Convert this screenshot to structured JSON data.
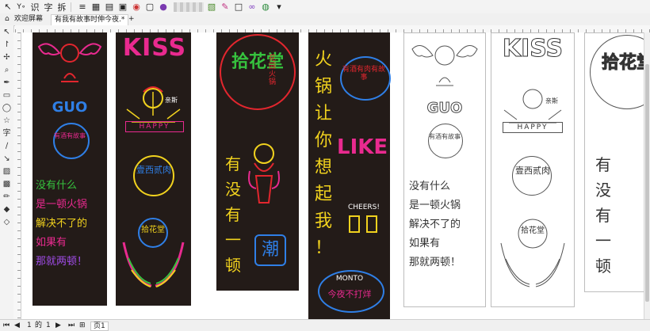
{
  "toolbar": {
    "items": [
      "识",
      "字",
      "拆"
    ],
    "icons": [
      "pointer-icon",
      "text-tool-icon",
      "grid-icon",
      "table-icon",
      "layout-icon",
      "color-icon",
      "palette-icon",
      "export-icon"
    ]
  },
  "tabs": [
    {
      "label": "欢迎屏幕"
    },
    {
      "label": "有我有故事时伸今夜.*"
    }
  ],
  "statusbar": {
    "page_current": "1",
    "page_of": "的",
    "page_total": "1",
    "page_tab": "页1"
  },
  "banners": {
    "b1_text": "没有什么是一顿火锅解决不了的如果有那就两顿！",
    "b1_lines": [
      "没有什么",
      "是一顿火锅",
      "解决不了的",
      "如果有",
      "那就两顿！"
    ],
    "b1_logo": "GUO",
    "b1_badge": "有酒有故事",
    "b2_kiss": "KISS",
    "b2_kiss_sub": "亲斯",
    "b2_happy": "HAPPY",
    "b2_meat": "壹西贰肉",
    "b2_cheers": "拾花堂",
    "b3_title": "拾花堂",
    "b3_sub": "花园火锅",
    "b3_lines": [
      "有",
      "没",
      "有",
      "一",
      "顿"
    ],
    "b3_bottom": "潮",
    "b4_lines": [
      "火",
      "锅",
      "让",
      "你",
      "想",
      "起",
      "我",
      "！"
    ],
    "b4_badge": "有酒有肉有故事",
    "b4_like": "LIKE",
    "b4_cheers": "CHEERS!",
    "b4_bottom": "今夜不打烊",
    "b4_monto": "MONTO"
  },
  "colors": {
    "banner_bg": "#231b18",
    "neon_red": "#e2262e",
    "neon_pink": "#e92a8f",
    "neon_blue": "#2f7fe6",
    "neon_green": "#36c23e",
    "neon_yellow": "#f1d21e",
    "neon_purple": "#a04ce8",
    "outline": "#555555"
  }
}
